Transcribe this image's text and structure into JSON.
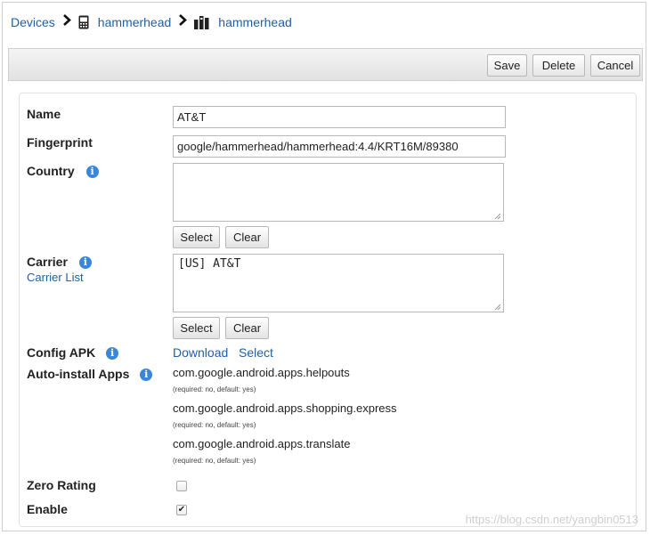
{
  "breadcrumb": {
    "items": [
      {
        "label": "Devices",
        "icon": ""
      },
      {
        "label": "hammerhead",
        "icon": "phone-icon"
      },
      {
        "label": "hammerhead",
        "icon": "device-bars-icon"
      }
    ],
    "separator": "›"
  },
  "toolbar": {
    "save_label": "Save",
    "delete_label": "Delete",
    "cancel_label": "Cancel"
  },
  "form": {
    "name": {
      "label": "Name",
      "value": "AT&T"
    },
    "fingerprint": {
      "label": "Fingerprint",
      "value": "google/hammerhead/hammerhead:4.4/KRT16M/89380"
    },
    "country": {
      "label": "Country",
      "info_icon": "info-icon",
      "value": "",
      "select_label": "Select",
      "clear_label": "Clear"
    },
    "carrier": {
      "label": "Carrier",
      "info_icon": "info-icon",
      "sublink": "Carrier List",
      "value": "[US] AT&T",
      "select_label": "Select",
      "clear_label": "Clear"
    },
    "config_apk": {
      "label": "Config APK",
      "info_icon": "info-icon",
      "download_label": "Download",
      "select_label": "Select"
    },
    "auto_install": {
      "label": "Auto-install Apps",
      "info_icon": "info-icon",
      "apps": [
        {
          "name": "com.google.android.apps.helpouts",
          "note": "(required: no, default: yes)"
        },
        {
          "name": "com.google.android.apps.shopping.express",
          "note": "(required: no, default: yes)"
        },
        {
          "name": "com.google.android.apps.translate",
          "note": "(required: no, default: yes)"
        }
      ]
    },
    "zero_rating": {
      "label": "Zero Rating",
      "checked": false
    },
    "enable": {
      "label": "Enable",
      "checked": true
    }
  },
  "watermark": "https://blog.csdn.net/yangbin0513",
  "colors": {
    "link": "#1f5fa6",
    "info": "#3a86d9",
    "border": "#b8b8b8"
  }
}
